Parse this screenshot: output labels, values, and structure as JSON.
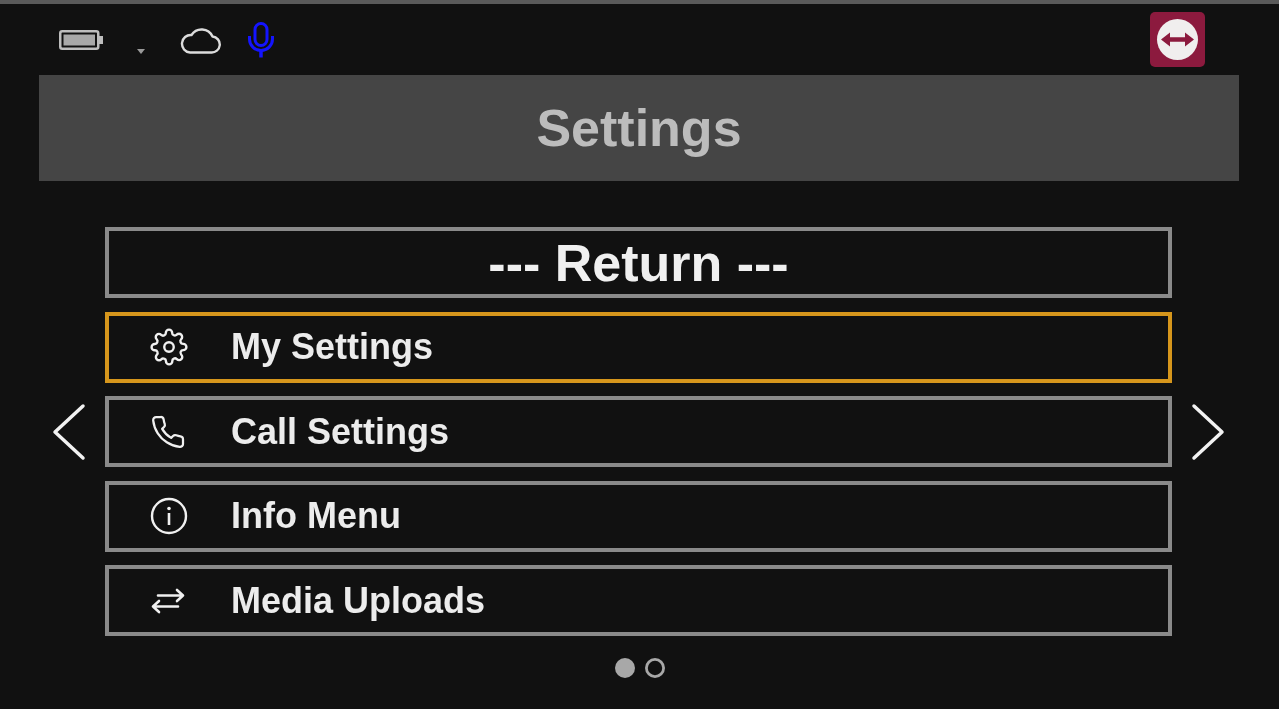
{
  "header": {
    "title": "Settings"
  },
  "menu": {
    "items": [
      {
        "kind": "return",
        "label": "--- Return ---",
        "selected": false
      },
      {
        "kind": "entry",
        "label": "My Settings",
        "selected": true
      },
      {
        "kind": "entry",
        "label": "Call Settings",
        "selected": false
      },
      {
        "kind": "entry",
        "label": "Info Menu",
        "selected": false
      },
      {
        "kind": "entry",
        "label": "Media Uploads",
        "selected": false
      }
    ]
  },
  "pager": {
    "pages": [
      {
        "selected": true
      },
      {
        "selected": false
      }
    ]
  }
}
